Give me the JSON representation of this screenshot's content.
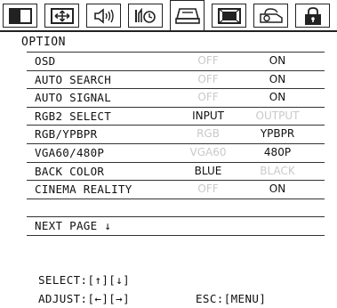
{
  "tabs": [
    {
      "icon": "picture-icon"
    },
    {
      "icon": "screen-position-icon"
    },
    {
      "icon": "audio-icon"
    },
    {
      "icon": "timer-icon"
    },
    {
      "icon": "setup-icon",
      "active": true
    },
    {
      "icon": "display-icon"
    },
    {
      "icon": "projector-icon"
    },
    {
      "icon": "lock-icon"
    }
  ],
  "panel": {
    "title": "OPTION"
  },
  "rows": [
    {
      "label": "OSD",
      "opt1": "OFF",
      "opt2": "ON",
      "selected": 2
    },
    {
      "label": "AUTO SEARCH",
      "opt1": "OFF",
      "opt2": "ON",
      "selected": 2
    },
    {
      "label": "AUTO SIGNAL",
      "opt1": "OFF",
      "opt2": "ON",
      "selected": 2
    },
    {
      "label": "RGB2 SELECT",
      "opt1": "INPUT",
      "opt2": "OUTPUT",
      "selected": 1
    },
    {
      "label": "RGB/YPBPR",
      "opt1": "RGB",
      "opt2": "YPBPR",
      "selected": 2
    },
    {
      "label": "VGA60/480P",
      "opt1": "VGA60",
      "opt2": "480P",
      "selected": 2
    },
    {
      "label": "BACK COLOR",
      "opt1": "BLUE",
      "opt2": "BLACK",
      "selected": 1
    },
    {
      "label": "CINEMA REALITY",
      "opt1": "OFF",
      "opt2": "ON",
      "selected": 2
    },
    {
      "label": "",
      "opt1": "",
      "opt2": "",
      "selected": 0
    },
    {
      "label": "NEXT PAGE ↓",
      "opt1": "",
      "opt2": "",
      "selected": 0
    }
  ],
  "footer": {
    "select": "SELECT:[↑][↓]",
    "adjust": "ADJUST:[←][→]",
    "esc": "ESC:[MENU]"
  }
}
